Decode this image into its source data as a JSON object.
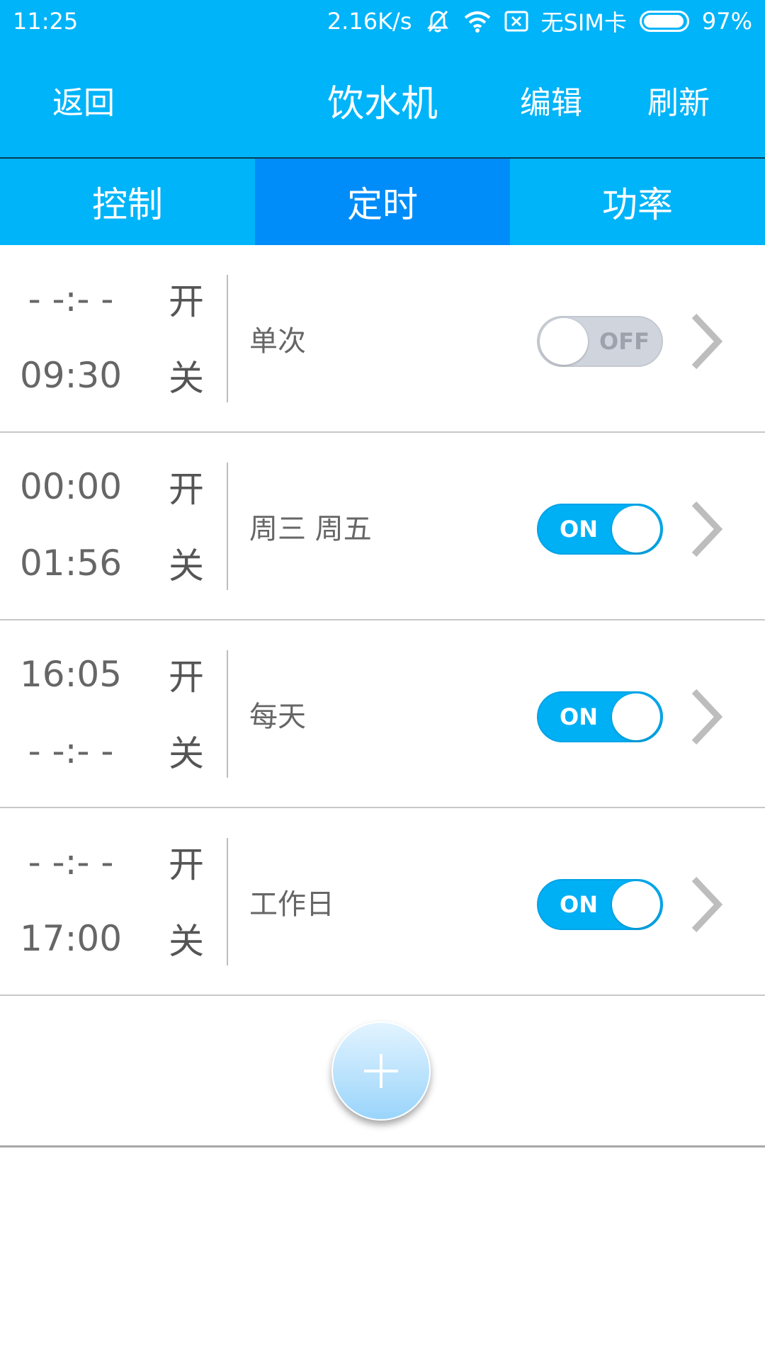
{
  "status_bar": {
    "time": "11:25",
    "net_speed": "2.16K/s",
    "sim_status": "无SIM卡",
    "battery": "97%",
    "battery_level": 0.97,
    "icons": [
      "mute-icon",
      "wifi-icon",
      "sim-card-icon",
      "battery-icon"
    ]
  },
  "title_bar": {
    "back_label": "返回",
    "title": "饮水机",
    "edit_label": "编辑",
    "refresh_label": "刷新"
  },
  "tabs": [
    {
      "label": "控制",
      "active": false
    },
    {
      "label": "定时",
      "active": true
    },
    {
      "label": "功率",
      "active": false
    }
  ],
  "timers": [
    {
      "on_time": "- -:- -",
      "on_label": "开",
      "off_time": "09:30",
      "off_label": "关",
      "repeat": "单次",
      "enabled": false,
      "toggle_text": "OFF"
    },
    {
      "on_time": "00:00",
      "on_label": "开",
      "off_time": "01:56",
      "off_label": "关",
      "repeat": "周三 周五",
      "enabled": true,
      "toggle_text": "ON"
    },
    {
      "on_time": "16:05",
      "on_label": "开",
      "off_time": "- -:- -",
      "off_label": "关",
      "repeat": "每天",
      "enabled": true,
      "toggle_text": "ON"
    },
    {
      "on_time": "- -:- -",
      "on_label": "开",
      "off_time": "17:00",
      "off_label": "关",
      "repeat": "工作日",
      "enabled": true,
      "toggle_text": "ON"
    }
  ],
  "colors": {
    "header_bg": "#00b4f9",
    "active_tab_bg": "#008df9",
    "toggle_on": "#00b0f5",
    "toggle_off": "#d0d4dc",
    "text_gray": "#666666"
  }
}
